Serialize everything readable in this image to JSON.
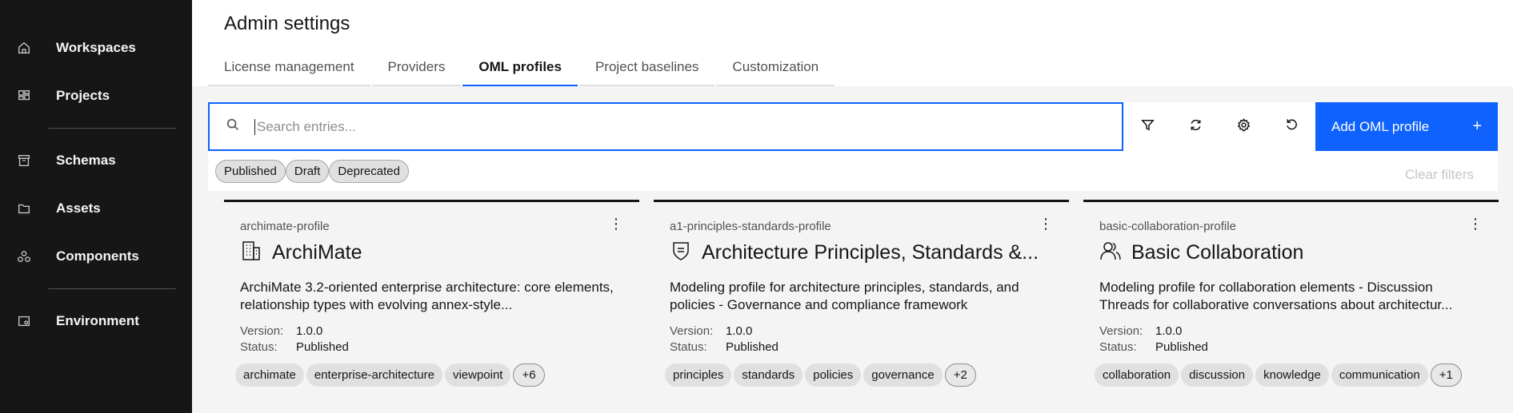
{
  "sidebar": {
    "items": [
      {
        "label": "Workspaces",
        "icon": "home-icon"
      },
      {
        "label": "Projects",
        "icon": "projects-icon"
      },
      {
        "label": "Schemas",
        "icon": "archive-icon"
      },
      {
        "label": "Assets",
        "icon": "folder-icon"
      },
      {
        "label": "Components",
        "icon": "components-icon"
      },
      {
        "label": "Environment",
        "icon": "environment-icon"
      }
    ]
  },
  "header": {
    "title": "Admin settings",
    "tabs": [
      {
        "label": "License management"
      },
      {
        "label": "Providers"
      },
      {
        "label": "OML profiles",
        "active": true
      },
      {
        "label": "Project baselines"
      },
      {
        "label": "Customization"
      }
    ]
  },
  "toolbar": {
    "search_placeholder": "Search entries...",
    "search_value": "",
    "add_label": "Add OML profile",
    "add_plus": "+"
  },
  "filters": {
    "chips": [
      "Published",
      "Draft",
      "Deprecated"
    ],
    "clear_label": "Clear filters"
  },
  "colors": {
    "accent": "#0f62fe",
    "sidebar_bg": "#161616"
  },
  "cards": [
    {
      "slug": "archimate-profile",
      "icon": "building-icon",
      "title": "ArchiMate",
      "description": "ArchiMate 3.2-oriented enterprise architecture: core elements, relationship types with evolving annex-style...",
      "version_label": "Version:",
      "version": "1.0.0",
      "status_label": "Status:",
      "status": "Published",
      "tags": [
        "archimate",
        "enterprise-architecture",
        "viewpoint"
      ],
      "more": "+6"
    },
    {
      "slug": "a1-principles-standards-profile",
      "icon": "shield-icon",
      "title": "Architecture Principles, Standards &...",
      "description": "Modeling profile for architecture principles, standards, and policies - Governance and compliance framework",
      "version_label": "Version:",
      "version": "1.0.0",
      "status_label": "Status:",
      "status": "Published",
      "tags": [
        "principles",
        "standards",
        "policies",
        "governance"
      ],
      "more": "+2"
    },
    {
      "slug": "basic-collaboration-profile",
      "icon": "user-group-icon",
      "title": "Basic Collaboration",
      "description": "Modeling profile for collaboration elements - Discussion Threads for collaborative conversations about architectur...",
      "version_label": "Version:",
      "version": "1.0.0",
      "status_label": "Status:",
      "status": "Published",
      "tags": [
        "collaboration",
        "discussion",
        "knowledge",
        "communication"
      ],
      "more": "+1"
    }
  ]
}
